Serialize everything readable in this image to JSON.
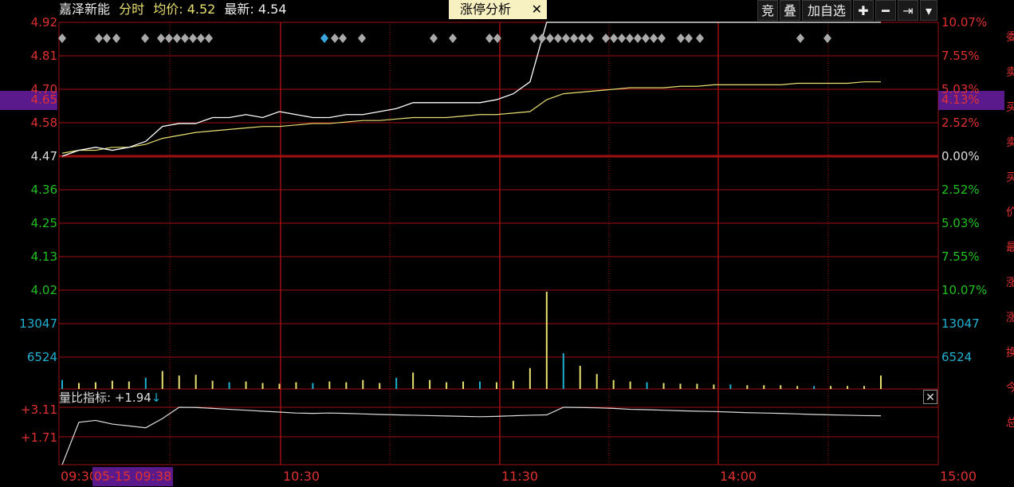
{
  "header": {
    "stock_name": "嘉泽新能",
    "mode_label": "分时",
    "avg_label": "均价: 4.52",
    "latest_label": "最新: 4.54"
  },
  "tab": {
    "label": "涨停分析",
    "close": "✕"
  },
  "toolbar": {
    "bid_label": "竞",
    "overlay_label": "叠",
    "add_watch_label": "加自选",
    "plus_label": "✚",
    "minus_label": "━",
    "end_label": "⇥",
    "more_label": "▾"
  },
  "price_axis": {
    "left": [
      {
        "text": "4.92",
        "color": "#e03030"
      },
      {
        "text": "4.81",
        "color": "#e03030"
      },
      {
        "text": "4.70",
        "color": "#e03030"
      },
      {
        "text": "4.58",
        "color": "#e03030"
      },
      {
        "text": "4.47",
        "color": "#dddddd"
      },
      {
        "text": "4.36",
        "color": "#20c020"
      },
      {
        "text": "4.25",
        "color": "#20c020"
      },
      {
        "text": "4.13",
        "color": "#20c020"
      },
      {
        "text": "4.02",
        "color": "#20c020"
      }
    ],
    "right": [
      {
        "text": "10.07%",
        "color": "#e03030"
      },
      {
        "text": "7.55%",
        "color": "#e03030"
      },
      {
        "text": "5.03%",
        "color": "#e03030"
      },
      {
        "text": "2.52%",
        "color": "#e03030"
      },
      {
        "text": "0.00%",
        "color": "#dddddd"
      },
      {
        "text": "2.52%",
        "color": "#20c020"
      },
      {
        "text": "5.03%",
        "color": "#20c020"
      },
      {
        "text": "7.55%",
        "color": "#20c020"
      },
      {
        "text": "10.07%",
        "color": "#20c020"
      }
    ],
    "current_left": "4.65",
    "current_right": "4.13%"
  },
  "volume_axis": {
    "labels": [
      "13047",
      "6524"
    ]
  },
  "indicator": {
    "title": "量比指标: +1.94",
    "arrow": "↓",
    "labels": [
      "+3.11",
      "+1.71"
    ],
    "close": "✕"
  },
  "time_axis": {
    "labels": [
      "09:30",
      "10:30",
      "11:30",
      "14:00",
      "15:00"
    ],
    "cursor": "05-15 09:38"
  },
  "side_panel": {
    "chars": [
      "委",
      "卖",
      "买",
      "卖",
      "买",
      "价",
      "最",
      "涨",
      "涨",
      "换",
      "今",
      "总"
    ]
  },
  "colors": {
    "grid": "#a01010",
    "price_line": "#ffffff",
    "avg_line": "#e8e070",
    "up": "#e03030",
    "down": "#20c020",
    "volume_label": "#20b0d0",
    "cursor_bg": "#5a1a8c"
  },
  "chart_data": {
    "type": "line",
    "x": [
      "09:30",
      "10:30",
      "11:30",
      "14:00",
      "15:00"
    ],
    "ylim": [
      4.02,
      4.92
    ],
    "pre_close": 4.47,
    "series": [
      {
        "values": [
          4.47,
          4.49,
          4.5,
          4.49,
          4.5,
          4.52,
          4.57,
          4.58,
          4.58,
          4.6,
          4.6,
          4.61,
          4.6,
          4.62,
          4.61,
          4.6,
          4.6,
          4.61,
          4.61,
          4.62,
          4.63,
          4.65,
          4.65,
          4.65,
          4.65,
          4.65,
          4.66,
          4.68,
          4.72,
          4.92,
          4.92,
          4.92,
          4.92,
          4.92,
          4.92,
          4.92,
          4.92,
          4.92,
          4.92,
          4.92,
          4.92,
          4.92,
          4.92,
          4.92,
          4.92,
          4.92,
          4.92,
          4.92,
          4.92,
          4.92
        ]
      },
      {
        "values": [
          4.48,
          4.49,
          4.49,
          4.5,
          4.5,
          4.51,
          4.53,
          4.54,
          4.55,
          4.555,
          4.56,
          4.565,
          4.57,
          4.57,
          4.575,
          4.58,
          4.58,
          4.585,
          4.59,
          4.59,
          4.595,
          4.6,
          4.6,
          4.6,
          4.605,
          4.61,
          4.61,
          4.615,
          4.62,
          4.66,
          4.68,
          4.685,
          4.69,
          4.695,
          4.7,
          4.7,
          4.7,
          4.705,
          4.705,
          4.71,
          4.71,
          4.71,
          4.71,
          4.71,
          4.715,
          4.715,
          4.715,
          4.715,
          4.72,
          4.72
        ]
      }
    ],
    "volume": [
      1200,
      800,
      900,
      1100,
      1000,
      1500,
      2400,
      1800,
      1900,
      1100,
      900,
      1000,
      800,
      700,
      900,
      800,
      1000,
      900,
      1200,
      800,
      1500,
      2200,
      1200,
      900,
      1000,
      1000,
      900,
      1100,
      2800,
      13047,
      4800,
      3100,
      2000,
      1200,
      1000,
      900,
      800,
      700,
      700,
      600,
      600,
      500,
      500,
      500,
      400,
      400,
      400,
      400,
      400,
      1800
    ],
    "volume_ratio": [
      0.0,
      2.3,
      2.4,
      2.2,
      2.1,
      2.0,
      2.5,
      3.11,
      3.1,
      3.05,
      3.0,
      2.95,
      2.9,
      2.85,
      2.8,
      2.78,
      2.8,
      2.78,
      2.75,
      2.72,
      2.7,
      2.68,
      2.66,
      2.64,
      2.62,
      2.6,
      2.62,
      2.65,
      2.68,
      2.7,
      3.11,
      3.1,
      3.08,
      3.05,
      3.0,
      2.98,
      2.95,
      2.92,
      2.9,
      2.88,
      2.85,
      2.82,
      2.8,
      2.78,
      2.75,
      2.72,
      2.7,
      2.68,
      2.66,
      2.65
    ]
  }
}
